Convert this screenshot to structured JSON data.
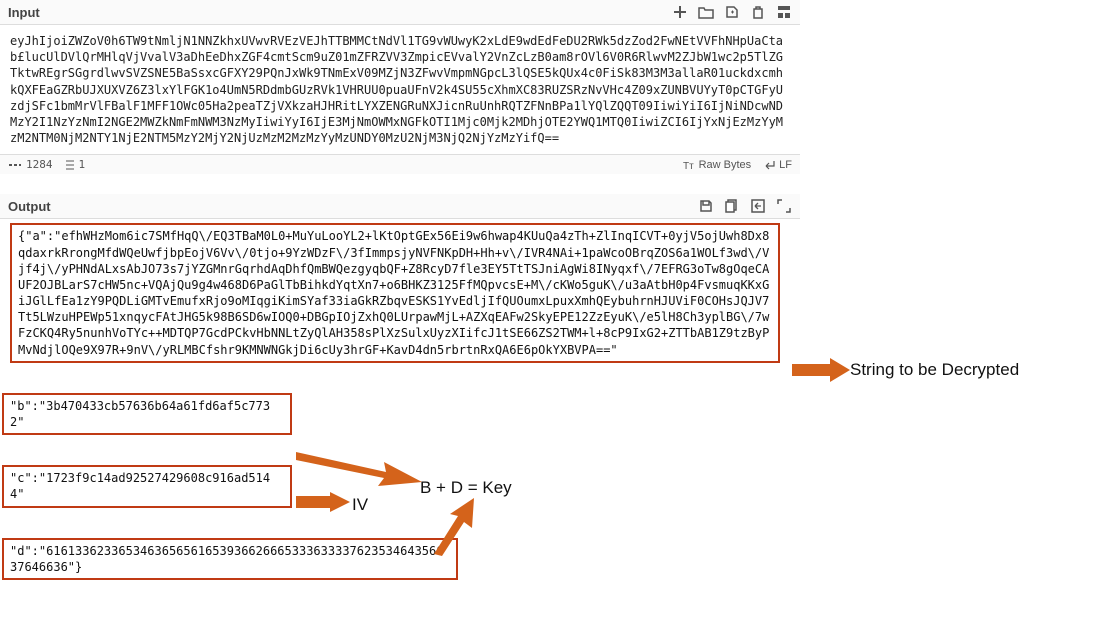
{
  "input": {
    "title": "Input",
    "text": "eyJhIjoiZWZoV0h6TW9tNmljN1NNZkhxUVwvRVEzVEJhTTBMMCtNdVl1TG9vWUwyK2xLdE9wdEdFeDU2RWk5dzZod2FwNEtVVFhNHpUaCtab£lucUlDVlQrMHlqVjVvalV3aDhEeDhxZGF4cmtScm9uZ01mZFRZVV3ZmpicEVvalY2VnZcLzB0am8rOVl6V0R6RlwvM2ZJbW1wc2p5TlZGTktwREgrSGgrdlwvSVZSNE5BaSsxcGFXY29PQnJxWk9TNmExV09MZjN3ZFwvVmpmNGpcL3lQSE5kQUx4c0FiSk83M3M3allaR01uckdxcmhkQXFEaGZRbUJXUXVZ6Z3lxYlFGK1o4UmN5RDdmbGUzRVk1VHRUU0puaUFnV2k4SU55cXhmXC83RUZSRzNvVHc4Z09xZUNBVUYyT0pCTGFyUzdjSFc1bmMrVlFBalF1MFF1OWc05Ha2peaTZjVXkzaHJHRitLYXZENGRuNXJicnRuUnhRQTZFNnBPa1lYQlZQQT09IiwiYiI6IjNiNDcwNDMzY2I1NzYzNmI2NGE2MWZkNmFmNWM3NzMyIiwiYyI6IjE3MjNmOWMxNGFkOTI1Mjc0Mjk2MDhjOTE2YWQ1MTQ0IiwiZCI6IjYxNjEzMzYyMzM2NTM0NjM2NTY1NjE2NTM5MzY2MjY2NjUzMzM2MzMzYyMzUNDY0MzU2NjM3NjQ2NjYzMzYifQ=="
  },
  "status": {
    "length_label": "1284",
    "lines_label": "1",
    "raw_bytes": "Raw Bytes",
    "lf": "LF"
  },
  "output": {
    "title": "Output",
    "a": "{\"a\":\"efhWHzMom6ic7SMfHqQ\\/EQ3TBaM0L0+MuYuLooYL2+lKtOptGEx56Ei9w6hwap4KUuQa4zTh+ZlInqICVT+0yjV5ojUwh8Dx8qdaxrkRrongMfdWQeUwfjbpEojV6Vv\\/0tjo+9YzWDzF\\/3fImmpsjyNVFNKpDH+Hh+v\\/IVR4NAi+1paWcoOBrqZOS6a1WOLf3wd\\/Vjf4j\\/yPHNdALxsAbJO73s7jYZGMnrGqrhdAqDhfQmBWQezgyqbQF+Z8RcyD7fle3EY5TtTSJniAgWi8INyqxf\\/7EFRG3oTw8gOqeCAUF2OJBLarS7cHW5nc+VQAjQu9g4w468D6PaGlTbBihkdYqtXn7+o6BHKZ3125FfMQpvcsE+M\\/cKWo5guK\\/u3aAtbH0p4FvsmuqKKxGiJGlLfEa1zY9PQDLiGMTvEmufxRjo9oMIqgiKimSYaf33iaGkRZbqvESKS1YvEdljIfQUOumxLpuxXmhQEybuhrnHJUViF0COHsJQJV7Tt5LWzuHPEWp51xnqycFAtJHG5k98B6SD6wIOQ0+DBGpIOjZxhQ0LUrpawMjL+AZXqEAFw2SkyEPE12ZzEyuK\\/e5lH8Ch3yplBG\\/7wFzCKQ4Ry5nunhVoTYc++MDTQP7GcdPCkvHbNNLtZyQlAH358sPlXzSulxUyzXIifcJ1tSE66ZS2TWM+l+8cP9IxG2+ZTTbAB1Z9tzByPMvNdjlOQe9X97R+9nV\\/yRLMBCfshr9KMNWNGkjDi6cUy3hrGF+KavD4dn5rbrtnRxQA6E6pOkYXBVPA==\"",
    "b": "\"b\":\"3b470433cb57636b64a61fd6af5c7732\"",
    "c": "\"c\":\"1723f9c14ad92527429608c916ad5144\"",
    "d": "\"d\":\"616133623365346365656165393662666533363333762353464356637646636\"}"
  },
  "annotations": {
    "decrypt": "String to be Decrypted",
    "iv": "IV",
    "key": "B + D = Key"
  }
}
